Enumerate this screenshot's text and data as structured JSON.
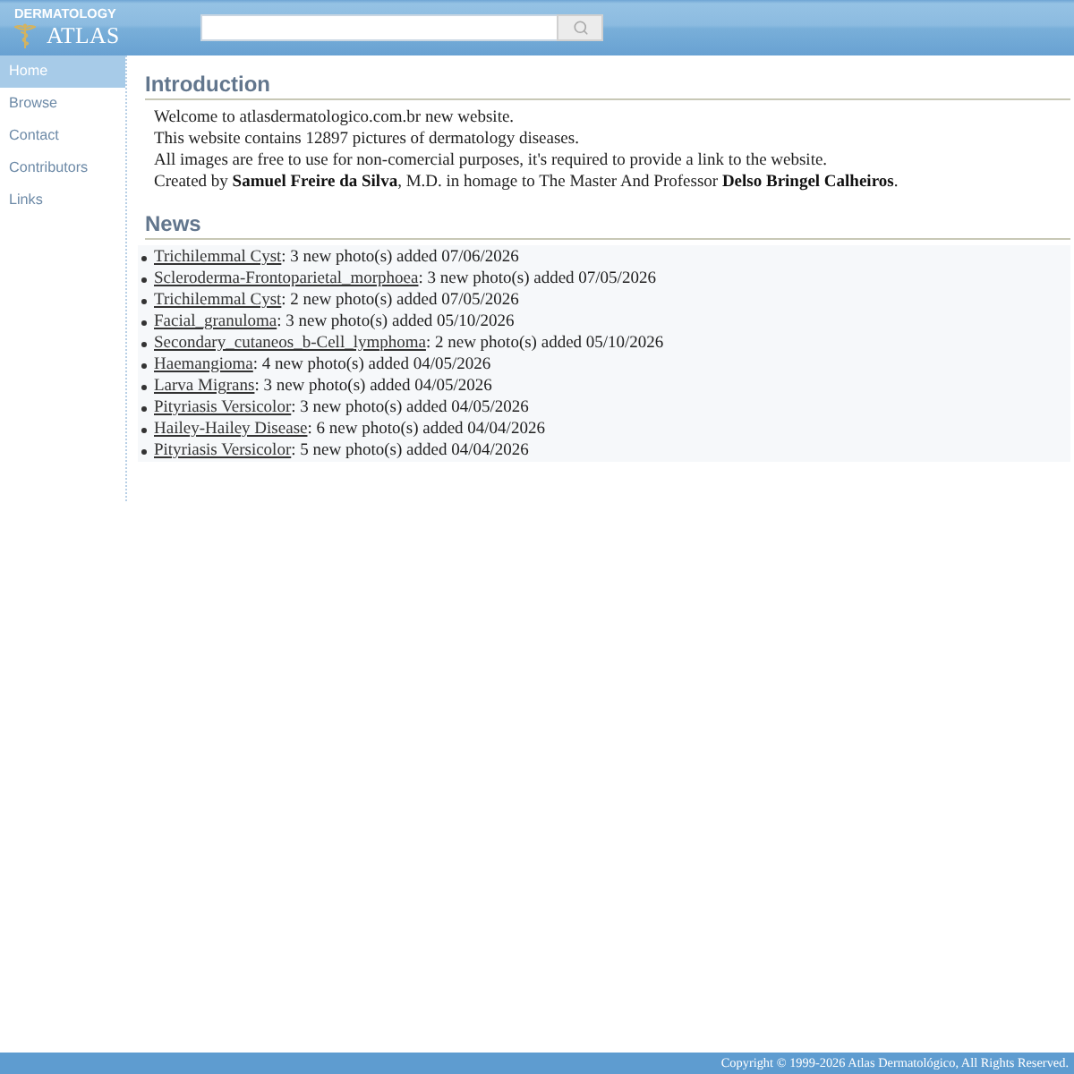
{
  "header": {
    "logo": {
      "subtitle": "DERMATOLOGY",
      "title": "ATLAS"
    }
  },
  "sidebar": {
    "items": [
      {
        "label": "Home",
        "selected": true
      },
      {
        "label": "Browse",
        "selected": false
      },
      {
        "label": "Contact",
        "selected": false
      },
      {
        "label": "Contributors",
        "selected": false
      },
      {
        "label": "Links",
        "selected": false
      }
    ]
  },
  "introduction": {
    "title": "Introduction",
    "lines": [
      "Welcome to atlasdermatologico.com.br new website.",
      "This website contains 12897 pictures of dermatology diseases.",
      "All images are free to use for non-comercial purposes, it's required to provide a link to the website.",
      "Created by **Samuel Freire da Silva**, M.D. in homage to The Master And Professor **Delso Bringel Calheiros**."
    ]
  },
  "news": {
    "title": "News",
    "items": [
      {
        "link": "Trichilemmal Cyst",
        "text": ": 3 new photo(s) added 07/06/2026"
      },
      {
        "link": "Scleroderma-Frontoparietal_morphoea",
        "text": ": 3 new photo(s) added 07/05/2026"
      },
      {
        "link": "Trichilemmal Cyst",
        "text": ": 2 new photo(s) added 07/05/2026"
      },
      {
        "link": "Facial_granuloma",
        "text": ": 3 new photo(s) added 05/10/2026"
      },
      {
        "link": "Secondary_cutaneos_b-Cell_lymphoma",
        "text": ": 2 new photo(s) added 05/10/2026"
      },
      {
        "link": "Haemangioma",
        "text": ": 4 new photo(s) added 04/05/2026"
      },
      {
        "link": "Larva Migrans",
        "text": ": 3 new photo(s) added 04/05/2026"
      },
      {
        "link": "Pityriasis Versicolor",
        "text": ": 3 new photo(s) added 04/05/2026"
      },
      {
        "link": "Hailey-Hailey Disease",
        "text": ": 6 new photo(s) added 04/04/2026"
      },
      {
        "link": "Pityriasis Versicolor",
        "text": ": 5 new photo(s) added 04/04/2026"
      }
    ]
  },
  "footer": {
    "copyright": "Copyright © 1999-2026 Atlas Dermatológico, All Rights Reserved."
  }
}
